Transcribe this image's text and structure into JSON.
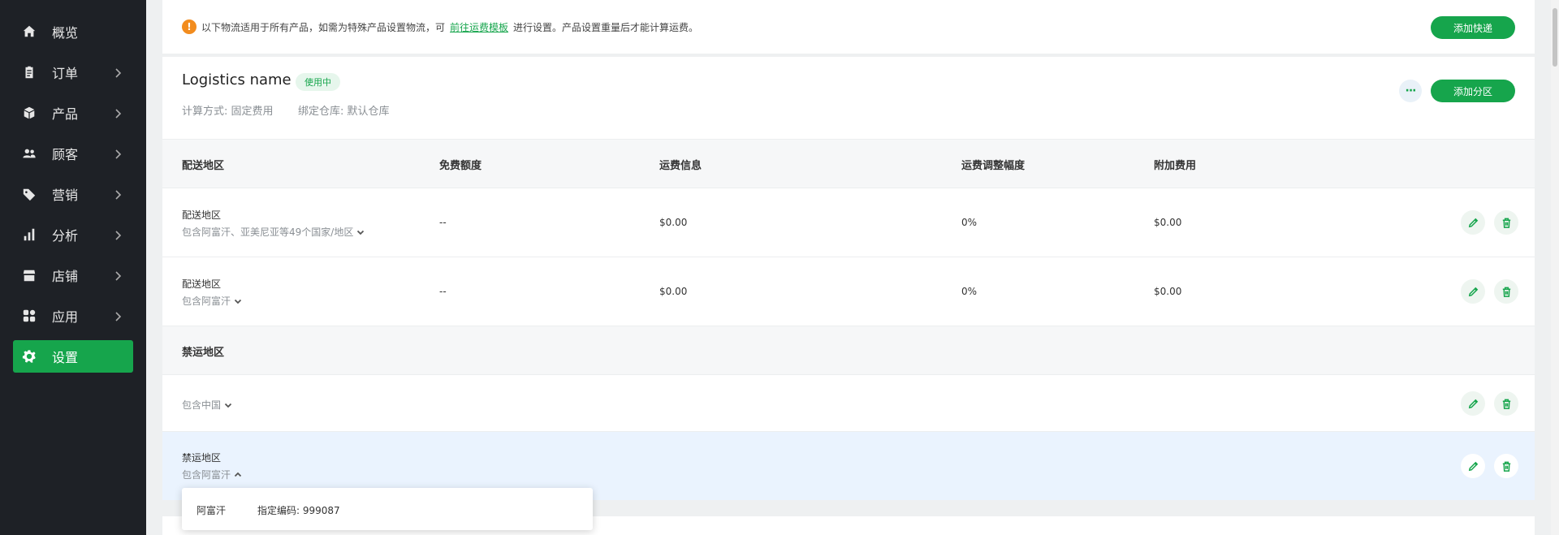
{
  "sidebar": {
    "items": [
      {
        "label": "概览",
        "icon": "home-icon",
        "has_chevron": false
      },
      {
        "label": "订单",
        "icon": "clipboard-icon",
        "has_chevron": true
      },
      {
        "label": "产品",
        "icon": "box-icon",
        "has_chevron": true
      },
      {
        "label": "顾客",
        "icon": "users-icon",
        "has_chevron": true
      },
      {
        "label": "营销",
        "icon": "tag-icon",
        "has_chevron": true
      },
      {
        "label": "分析",
        "icon": "bar-chart-icon",
        "has_chevron": true
      },
      {
        "label": "店铺",
        "icon": "store-icon",
        "has_chevron": true
      },
      {
        "label": "应用",
        "icon": "apps-icon",
        "has_chevron": true
      },
      {
        "label": "设置",
        "icon": "gear-icon",
        "has_chevron": false,
        "active": true
      }
    ],
    "accent": "#16a54c"
  },
  "notice": {
    "text_before": "以下物流适用于所有产品，如需为特殊产品设置物流，可",
    "link": "前往运费模板",
    "text_after": "进行设置。产品设置重量后才能计算运费。",
    "button": "添加快递"
  },
  "logistics": {
    "name": "Logistics name",
    "status": "使用中",
    "calc_method": "计算方式: 固定费用",
    "warehouse": "绑定仓库: 默认仓库",
    "more": "···",
    "add_zone": "添加分区"
  },
  "table": {
    "headers": [
      "配送地区",
      "免费额度",
      "运费信息",
      "运费调整幅度",
      "附加费用"
    ],
    "rows": [
      {
        "title": "配送地区",
        "detail": "包含阿富汗、亚美尼亚等49个国家/地区",
        "free": "--",
        "fee": "$0.00",
        "adjust": "0%",
        "extra": "$0.00"
      },
      {
        "title": "配送地区",
        "detail": "包含阿富汗",
        "free": "--",
        "fee": "$0.00",
        "adjust": "0%",
        "extra": "$0.00"
      }
    ],
    "restricted_header": "禁运地区",
    "restricted": [
      {
        "title": "",
        "detail": "包含中国"
      },
      {
        "title": "禁运地区",
        "detail": "包含阿富汗"
      }
    ]
  },
  "popover": {
    "country": "阿富汗",
    "code": "指定编码: 999087"
  }
}
